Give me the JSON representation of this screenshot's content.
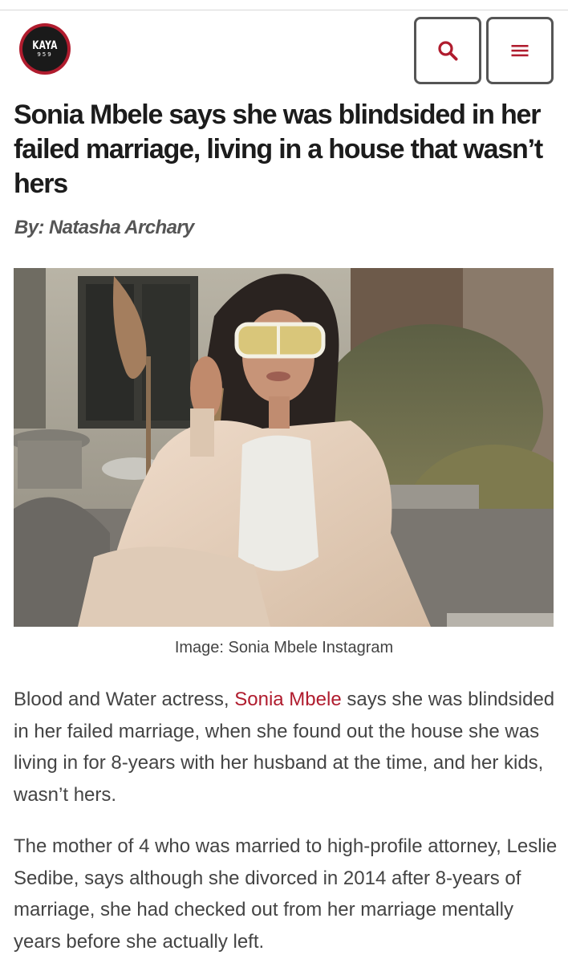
{
  "site": {
    "logo_word": "KAYA",
    "logo_number": "959",
    "brand_color": "#b01c2e"
  },
  "header": {
    "search_icon": "search-icon",
    "menu_icon": "hamburger-menu-icon"
  },
  "article": {
    "title": "Sonia Mbele says she was blindsided in her failed marriage, living in a house that wasn’t hers",
    "byline": "By: Natasha Archary",
    "image_caption": "Image: Sonia Mbele Instagram",
    "p1_prefix": "Blood and Water actress, ",
    "p1_link": "Sonia Mbele",
    "p1_suffix": " says she was blindsided in her failed marriage, when she found out the house she was living in for 8-years with her husband at the time, and her kids, wasn’t hers.",
    "p2": "The mother of 4 who was married to high-profile attorney, Leslie Sedibe, says although she divorced in 2014 after 8-years of marriage, she had checked out from her marriage mentally years before she actually left."
  }
}
